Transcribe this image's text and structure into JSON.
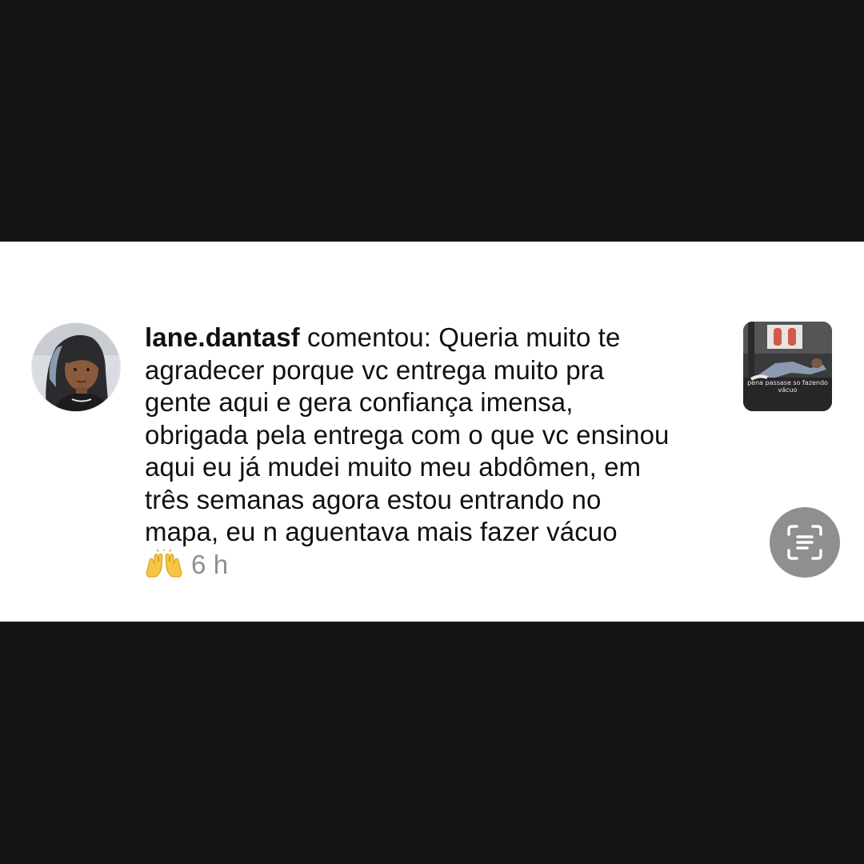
{
  "notification": {
    "username": "lane.dantasf",
    "lines": [
      " comentou: Queria muito te",
      "agradecer porque vc entrega muito pra",
      "gente aqui e gera confiança imensa,",
      "obrigada pela entrega com o que vc ensinou",
      "aqui eu já mudei muito meu abdômen, em",
      "três semanas agora estou entrando no",
      "mapa, eu n aguentava mais fazer vácuo"
    ],
    "emoji": "raising-hands-emoji",
    "time": "6 h",
    "thumbnail_caption": "pena passase so fazendo vácuo"
  },
  "icons": {
    "scan": "scan-text-icon"
  },
  "colors": {
    "background_bars": "#151515",
    "panel": "#ffffff",
    "text": "#111111",
    "muted": "#8e8e8e",
    "scan_button": "#8f8f8f"
  }
}
